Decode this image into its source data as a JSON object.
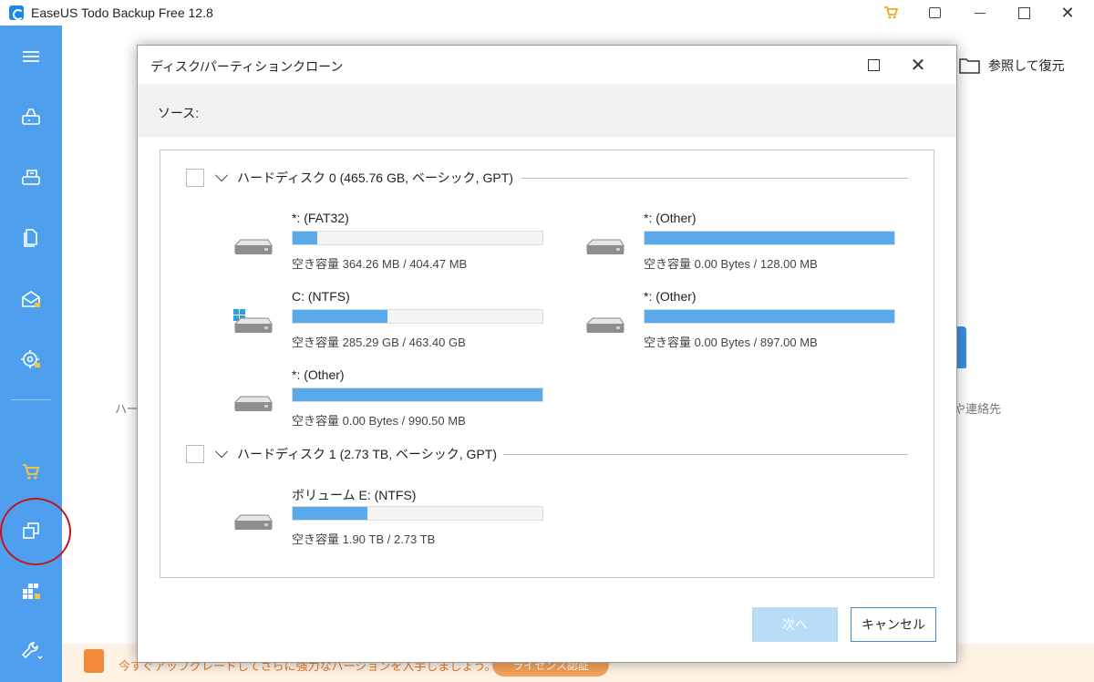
{
  "window": {
    "title": "EaseUS Todo Backup Free 12.8",
    "close_glyph": "✕"
  },
  "sidebar": {
    "items": [
      {
        "icon": "menu-icon"
      },
      {
        "icon": "disk-backup-icon"
      },
      {
        "icon": "system-backup-icon"
      },
      {
        "icon": "file-backup-icon"
      },
      {
        "icon": "mail-backup-icon"
      },
      {
        "icon": "smart-backup-icon"
      },
      {
        "icon": "cart-icon"
      },
      {
        "icon": "clone-icon"
      },
      {
        "icon": "tools-grid-icon"
      },
      {
        "icon": "wrench-icon"
      }
    ],
    "accent": "#4ea0ef",
    "highlight_color": "#c3141b"
  },
  "main": {
    "restore_label": "参照して復元",
    "left_fragment": "ハー",
    "right_fragment": "や連絡先"
  },
  "bottom_bar": {
    "text": "今すぐアップグレードしてさらに強力なバージョンを入手しましょう。",
    "license_label": "ライセンス認証"
  },
  "dialog": {
    "title": "ディスク/パーティションクローン",
    "close_glyph": "✕",
    "source_label": "ソース:",
    "disks": [
      {
        "title": "ハードディスク 0 (465.76 GB, ベーシック, GPT)",
        "partitions": [
          {
            "name": "*: (FAT32)",
            "free": "空き容量 364.26 MB / 404.47 MB",
            "used_fraction": 0.1,
            "icon": "drive-icon"
          },
          {
            "name": "*: (Other)",
            "free": "空き容量 0.00 Bytes / 128.00 MB",
            "used_fraction": 1.0,
            "icon": "drive-icon"
          },
          {
            "name": "C: (NTFS)",
            "free": "空き容量 285.29 GB / 463.40 GB",
            "used_fraction": 0.38,
            "icon": "windows-drive-icon"
          },
          {
            "name": "*: (Other)",
            "free": "空き容量 0.00 Bytes / 897.00 MB",
            "used_fraction": 1.0,
            "icon": "drive-icon"
          },
          {
            "name": "*: (Other)",
            "free": "空き容量 0.00 Bytes / 990.50 MB",
            "used_fraction": 1.0,
            "icon": "drive-icon"
          }
        ]
      },
      {
        "title": "ハードディスク 1 (2.73 TB, ベーシック, GPT)",
        "partitions": [
          {
            "name": "ボリューム E: (NTFS)",
            "free": "空き容量 1.90 TB / 2.73 TB",
            "used_fraction": 0.3,
            "icon": "drive-icon"
          }
        ]
      }
    ],
    "next_label": "次へ",
    "cancel_label": "キャンセル",
    "bar_color": "#5aa9eb"
  }
}
